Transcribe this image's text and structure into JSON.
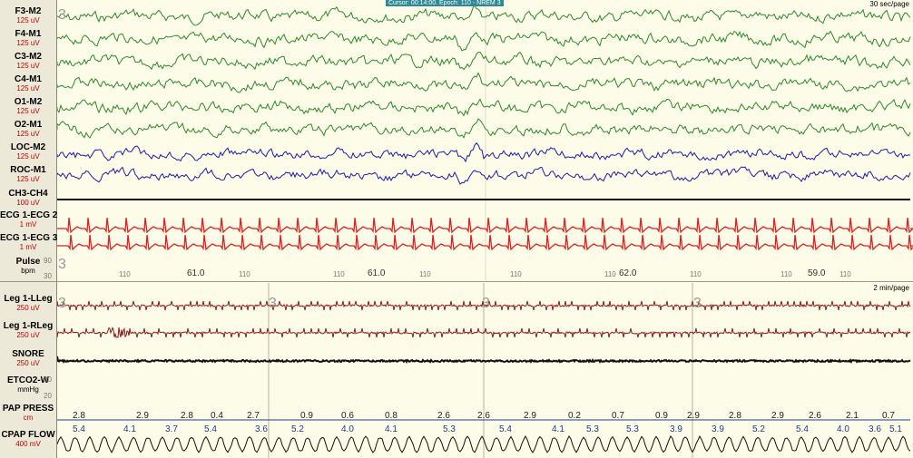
{
  "header": {
    "cursor_text": "Cursor: 00:14:00. Epoch: 110 - NREM 3",
    "epoch_speed": "30 sec/page",
    "lower_speed": "2 min/page"
  },
  "channels": [
    {
      "name": "F3-M2",
      "scale": "125 uV",
      "color": "#2a8a2a"
    },
    {
      "name": "F4-M1",
      "scale": "125 uV",
      "color": "#2a8a2a"
    },
    {
      "name": "C3-M2",
      "scale": "125 uV",
      "color": "#2a8a2a"
    },
    {
      "name": "C4-M1",
      "scale": "125 uV",
      "color": "#2a8a2a"
    },
    {
      "name": "O1-M2",
      "scale": "125 uV",
      "color": "#2a8a2a"
    },
    {
      "name": "O2-M1",
      "scale": "125 uV",
      "color": "#2a8a2a"
    },
    {
      "name": "LOC-M2",
      "scale": "125 uV",
      "color": "#1c1caa"
    },
    {
      "name": "ROC-M1",
      "scale": "125 uV",
      "color": "#1c1caa"
    },
    {
      "name": "CH3-CH4",
      "scale": "100 uV",
      "color": "#111111"
    },
    {
      "name": "ECG 1-ECG 2",
      "scale": "1 mV",
      "color": "#e02020"
    },
    {
      "name": "ECG 1-ECG 3",
      "scale": "1 mV",
      "color": "#e02020"
    },
    {
      "name": "Pulse",
      "scale": "bpm",
      "color": "#555555"
    },
    {
      "name": "Leg 1-LLeg",
      "scale": "250 uV",
      "color": "#8b1a1a"
    },
    {
      "name": "Leg 1-RLeg",
      "scale": "250 uV",
      "color": "#8b1a1a"
    },
    {
      "name": "SNORE",
      "scale": "250 uV",
      "color": "#111111"
    },
    {
      "name": "ETCO2-W",
      "scale": "mmHg",
      "color": "#555555"
    },
    {
      "name": "PAP PRESS",
      "scale": "cm",
      "color": "#1e3a8a"
    },
    {
      "name": "CPAP FLOW",
      "scale": "400 mV",
      "color": "#111111"
    }
  ],
  "pulse": {
    "axis_top": "90",
    "axis_bottom": "30",
    "small_marks": [
      "110",
      "110",
      "110",
      "110",
      "110",
      "110",
      "110",
      "110",
      "110"
    ],
    "values": [
      "61.0",
      "61.0",
      "62.0",
      "59.0"
    ]
  },
  "etco2": {
    "axis_top": "80",
    "axis_bottom": "20"
  },
  "pap_press_values": [
    "2.8",
    "2.9",
    "2.8",
    "0.4",
    "2.7",
    "0.9",
    "0.6",
    "0.8",
    "2.6",
    "2.6",
    "2.9",
    "0.2",
    "0.7",
    "0.9",
    "2.9",
    "2.8",
    "2.9",
    "2.6",
    "2.1",
    "0.7"
  ],
  "cpap_flow_values": [
    "5.4",
    "4.1",
    "3.7",
    "5.4",
    "3.6",
    "5.2",
    "4.0",
    "4.1",
    "5.3",
    "5.4",
    "4.1",
    "5.3",
    "5.3",
    "3.9",
    "3.9",
    "5.2",
    "5.4",
    "4.0",
    "3.6",
    "5.1"
  ],
  "marker_glyph": "3"
}
